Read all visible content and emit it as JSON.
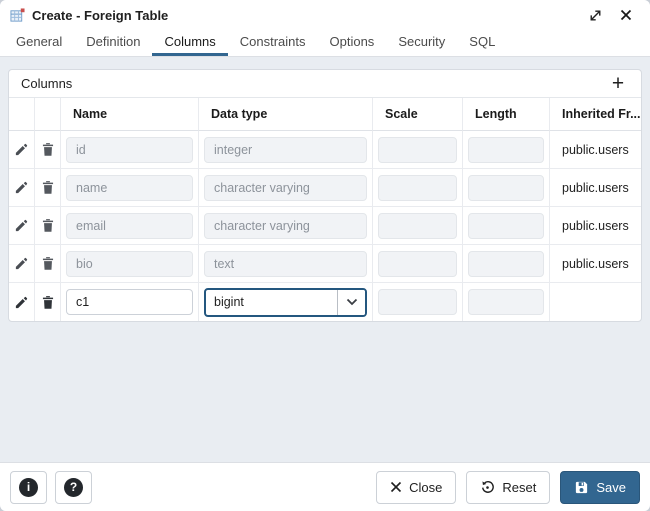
{
  "window": {
    "title": "Create - Foreign Table"
  },
  "icons": {
    "plus": "+",
    "info": "i",
    "help": "?"
  },
  "tabs": [
    {
      "label": "General",
      "active": false
    },
    {
      "label": "Definition",
      "active": false
    },
    {
      "label": "Columns",
      "active": true
    },
    {
      "label": "Constraints",
      "active": false
    },
    {
      "label": "Options",
      "active": false
    },
    {
      "label": "Security",
      "active": false
    },
    {
      "label": "SQL",
      "active": false
    }
  ],
  "columns_panel": {
    "title": "Columns"
  },
  "columns_table": {
    "headers": {
      "name": "Name",
      "data_type": "Data type",
      "scale": "Scale",
      "length": "Length",
      "inherited": "Inherited Fr..."
    },
    "rows": [
      {
        "name": "id",
        "data_type": "integer",
        "scale": "",
        "length": "",
        "inherited_from": "public.users"
      },
      {
        "name": "name",
        "data_type": "character varying",
        "scale": "",
        "length": "",
        "inherited_from": "public.users"
      },
      {
        "name": "email",
        "data_type": "character varying",
        "scale": "",
        "length": "",
        "inherited_from": "public.users"
      },
      {
        "name": "bio",
        "data_type": "text",
        "scale": "",
        "length": "",
        "inherited_from": "public.users"
      },
      {
        "name": "c1",
        "data_type": "bigint",
        "scale": "",
        "length": "",
        "inherited_from": ""
      }
    ]
  },
  "footer": {
    "close_label": "Close",
    "reset_label": "Reset",
    "save_label": "Save"
  },
  "colors": {
    "accent": "#326690",
    "focus_border": "#24577f",
    "disabled_field_bg": "#f1f3f6",
    "content_bg": "#e9edf2"
  }
}
